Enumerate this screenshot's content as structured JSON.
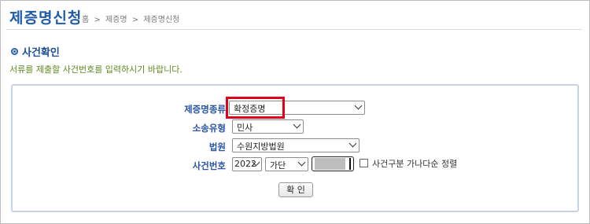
{
  "page": {
    "title": "제증명신청",
    "breadcrumb": [
      "홈",
      ">",
      "제증명",
      ">",
      "제증명신청"
    ]
  },
  "section": {
    "heading": "사건확인",
    "instruction": "서류를 제출할 사건번호를 입력하시기 바랍니다."
  },
  "form": {
    "cert_type": {
      "label": "제증명종류",
      "value": "확정증명"
    },
    "lawsuit_type": {
      "label": "소송유형",
      "value": "민사"
    },
    "court": {
      "label": "법원",
      "value": "수원지방법원"
    },
    "case_number": {
      "label": "사건번호",
      "year": "2022",
      "category": "가단",
      "number_masked": ""
    },
    "sort_checkbox": {
      "label": "사건구분 가나다순 정렬",
      "checked": false
    },
    "confirm_button": "확 인"
  },
  "colors": {
    "title_blue": "#1f5ca8",
    "label_blue": "#2a56a3",
    "instruction_green": "#5f8a1e",
    "highlight_red": "#e0001b"
  }
}
